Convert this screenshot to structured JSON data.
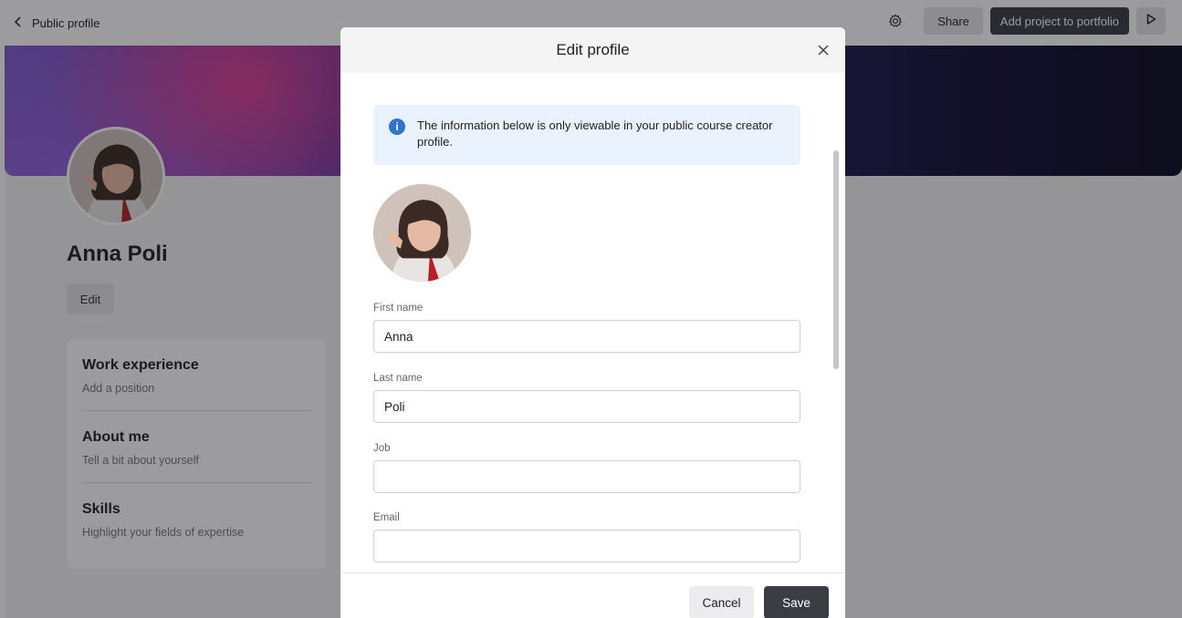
{
  "topbar": {
    "back_label": "Public profile",
    "share_label": "Share",
    "add_project_label": "Add project to portfolio",
    "icons": [
      "chevron-left-icon",
      "gear-icon",
      "play-icon"
    ]
  },
  "profile": {
    "name": "Anna Poli",
    "edit_label": "Edit",
    "sections": [
      {
        "title": "Work experience",
        "subtitle": "Add a position"
      },
      {
        "title": "About me",
        "subtitle": "Tell a bit about yourself"
      },
      {
        "title": "Skills",
        "subtitle": "Highlight your fields of expertise"
      }
    ]
  },
  "modal": {
    "title": "Edit profile",
    "info_text": "The information below is only viewable in your public course creator profile.",
    "fields": {
      "first_name": {
        "label": "First name",
        "value": "Anna"
      },
      "last_name": {
        "label": "Last name",
        "value": "Poli"
      },
      "job": {
        "label": "Job",
        "value": ""
      },
      "email": {
        "label": "Email",
        "value": ""
      }
    },
    "cancel_label": "Cancel",
    "save_label": "Save"
  },
  "colors": {
    "primary_dark": "#3a3d44",
    "info_bg": "#eaf2fd",
    "info_icon": "#2f74d0",
    "overlay": "rgba(20,20,24,0.42)"
  }
}
